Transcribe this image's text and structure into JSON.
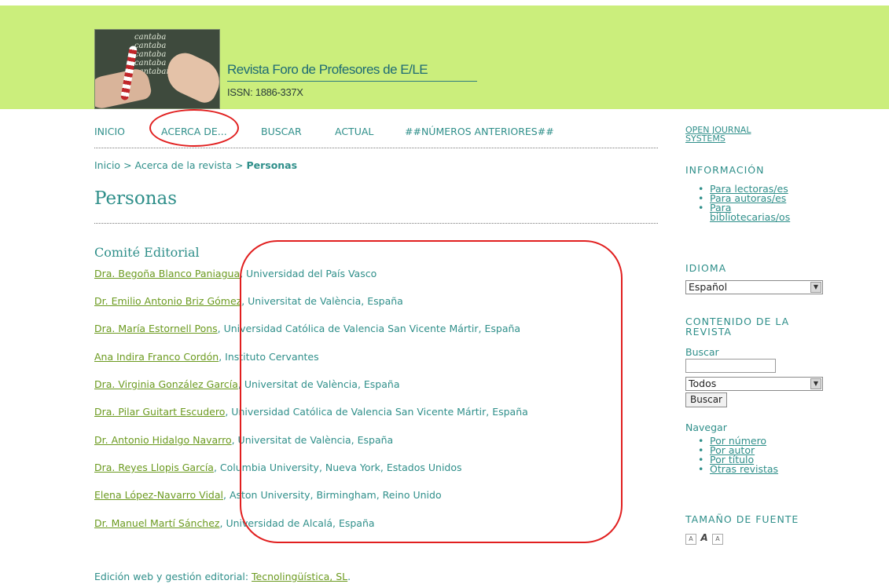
{
  "header": {
    "journal_title": "Revista Foro de Profesores de E/LE",
    "issn": "ISSN: 1886-337X",
    "logo_chalk_text": [
      "cantaba",
      "cantaba",
      "cantaba",
      "cantaba",
      "cantaban"
    ]
  },
  "nav": {
    "items": [
      "INICIO",
      "ACERCA DE...",
      "BUSCAR",
      "ACTUAL",
      "##NÚMEROS ANTERIORES##"
    ]
  },
  "breadcrumb": {
    "home": "Inicio",
    "sep": ">",
    "about": "Acerca de la revista",
    "current": "Personas"
  },
  "page": {
    "title": "Personas",
    "section_title": "Comité Editorial"
  },
  "members": [
    {
      "name": "Dra. Begoña Blanco Paniagua",
      "affiliation": ", Universidad del País Vasco"
    },
    {
      "name": "Dr. Emilio Antonio Briz Gómez",
      "affiliation": ", Universitat de València, España"
    },
    {
      "name": "Dra. María Estornell Pons",
      "affiliation": ", Universidad Católica de Valencia San Vicente Mártir, España"
    },
    {
      "name": "Ana Indira Franco Cordón",
      "affiliation": ", Instituto Cervantes"
    },
    {
      "name": "Dra. Virginia González García",
      "affiliation": ", Universitat de València, España"
    },
    {
      "name": "Dra. Pilar Guitart Escudero",
      "affiliation": ", Universidad Católica de Valencia San Vicente Mártir, España"
    },
    {
      "name": "Dr. Antonio Hidalgo Navarro",
      "affiliation": ", Universitat de València, España"
    },
    {
      "name": "Dra. Reyes Llopis García",
      "affiliation": ", Columbia University, Nueva York, Estados Unidos"
    },
    {
      "name": "Elena López-Navarro Vidal",
      "affiliation": ", Aston University, Birmingham, Reino Unido"
    },
    {
      "name": "Dr. Manuel Martí Sánchez",
      "affiliation": ", Universidad de Alcalá, España"
    }
  ],
  "footer": {
    "text": "Edición web y gestión editorial: ",
    "link": "Tecnolingüística, SL",
    "end": "."
  },
  "sidebar": {
    "ojs_line1": "OPEN JOURNAL",
    "ojs_line2": "SYSTEMS",
    "info_heading": "INFORMACIÓN",
    "info_links": [
      "Para lectoras/es",
      "Para autoras/es",
      "Para",
      "bibliotecarias/os"
    ],
    "lang_heading": "IDIOMA",
    "lang_selected": "Español",
    "content_heading_1": "CONTENIDO DE LA",
    "content_heading_2": "REVISTA",
    "search_label": "Buscar",
    "search_scope": "Todos",
    "search_button": "Buscar",
    "browse_label": "Navegar",
    "browse_links": [
      "Por número",
      "Por autor",
      "Por título",
      "Otras revistas"
    ],
    "font_heading": "TAMAÑO DE FUENTE",
    "font_buttons": [
      "A",
      "A",
      "A"
    ]
  },
  "colors": {
    "header_bg": "#cbee7c",
    "text_teal": "#2f8f8a",
    "link_green": "#6b9a1f",
    "annotation_red": "#e11f1f"
  }
}
